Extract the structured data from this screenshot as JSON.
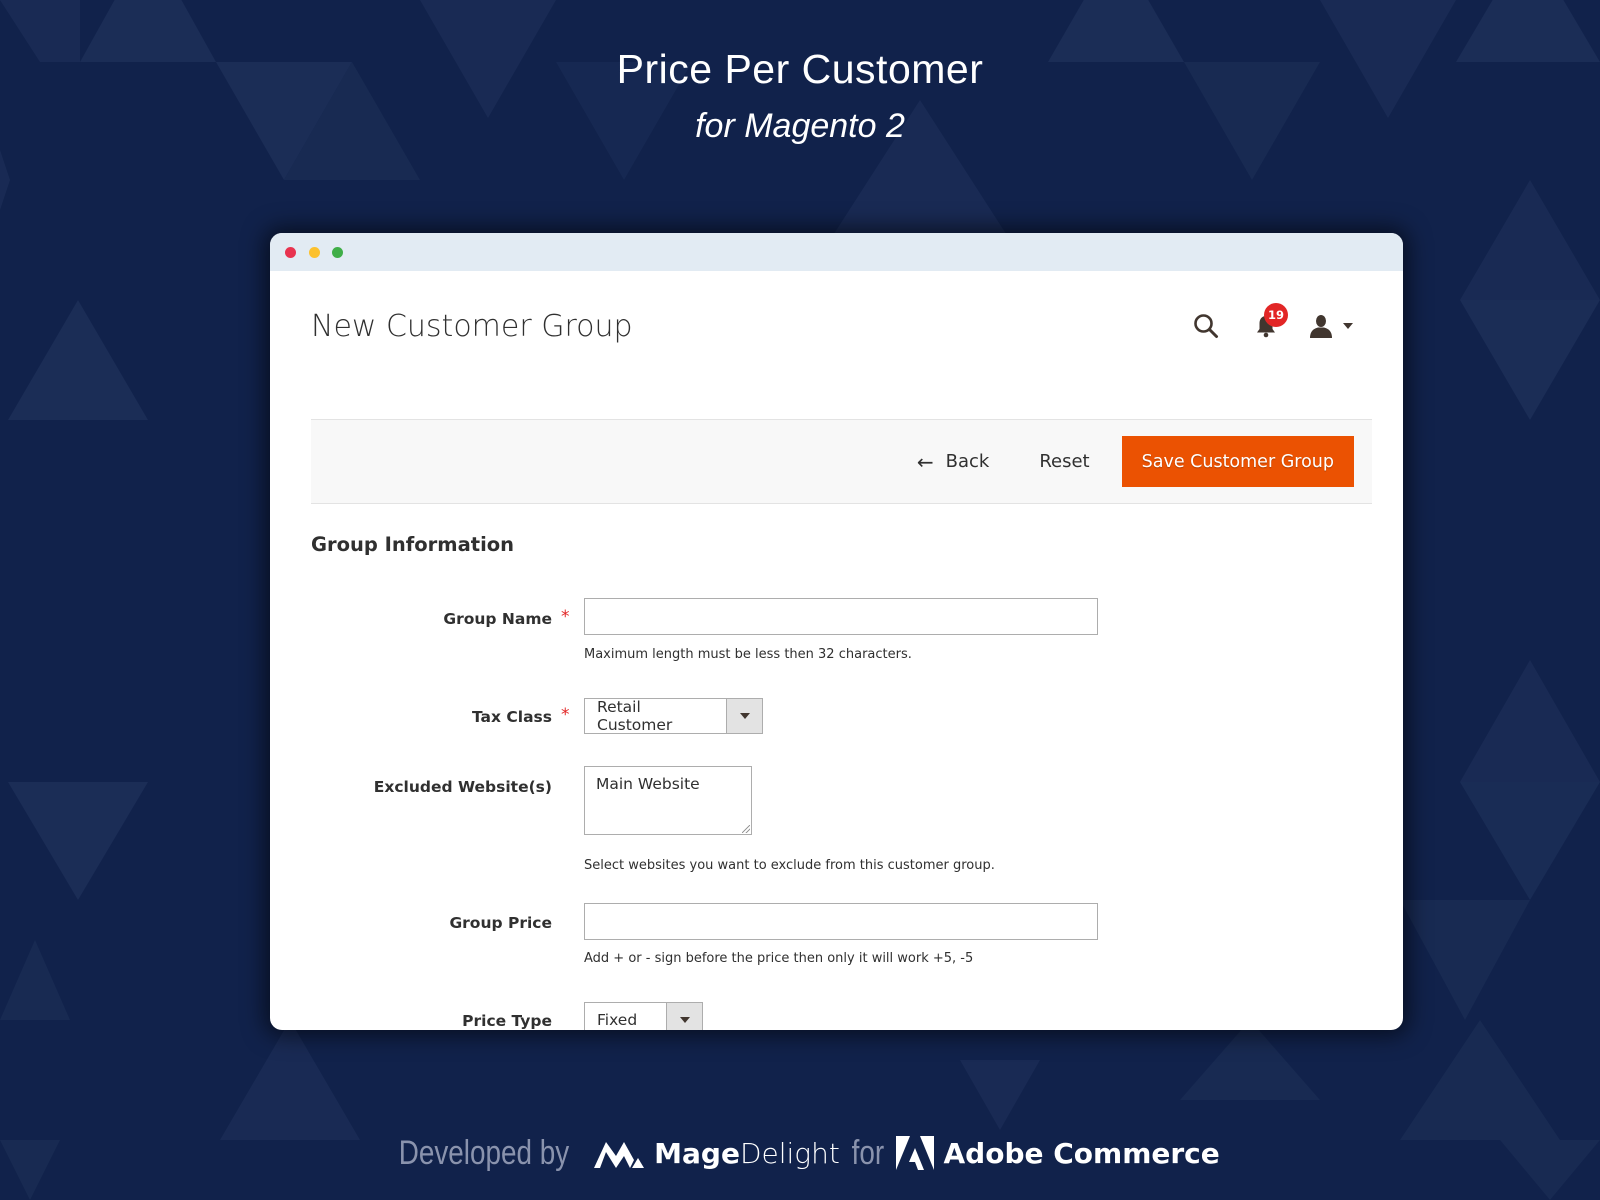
{
  "hero": {
    "title": "Price Per Customer",
    "subtitle": "for Magento 2"
  },
  "window": {
    "controls": [
      "close",
      "minimize",
      "maximize"
    ]
  },
  "header": {
    "page_title": "New Customer Group",
    "icons": {
      "search": "search-icon",
      "notifications": "bell-icon",
      "user": "user-icon"
    },
    "notification_count": "19"
  },
  "actions": {
    "back_label": "Back",
    "reset_label": "Reset",
    "save_label": "Save Customer Group"
  },
  "form": {
    "section_title": "Group Information",
    "fields": [
      {
        "label": "Group Name",
        "required": true,
        "type": "text",
        "value": "",
        "note": "Maximum length must be less then 32 characters."
      },
      {
        "label": "Tax Class",
        "required": true,
        "type": "select",
        "value": "Retail Customer"
      },
      {
        "label": "Excluded Website(s)",
        "required": false,
        "type": "multiselect",
        "options": [
          "Main Website"
        ],
        "note": "Select websites you want to exclude from this customer group."
      },
      {
        "label": "Group Price",
        "required": false,
        "type": "text",
        "value": "",
        "note": "Add + or - sign before the price then only it will work +5, -5"
      },
      {
        "label": "Price Type",
        "required": false,
        "type": "select",
        "value": "Fixed"
      }
    ],
    "required_marker": "*"
  },
  "footer": {
    "developed_by": "Developed by",
    "brand_bold": "Mage",
    "brand_light": "Delight",
    "for_text": "for",
    "platform": "Adobe Commerce"
  },
  "colors": {
    "background": "#11224b",
    "primary_button": "#eb5202",
    "badge": "#e22626",
    "titlebar": "#e2ebf3"
  }
}
